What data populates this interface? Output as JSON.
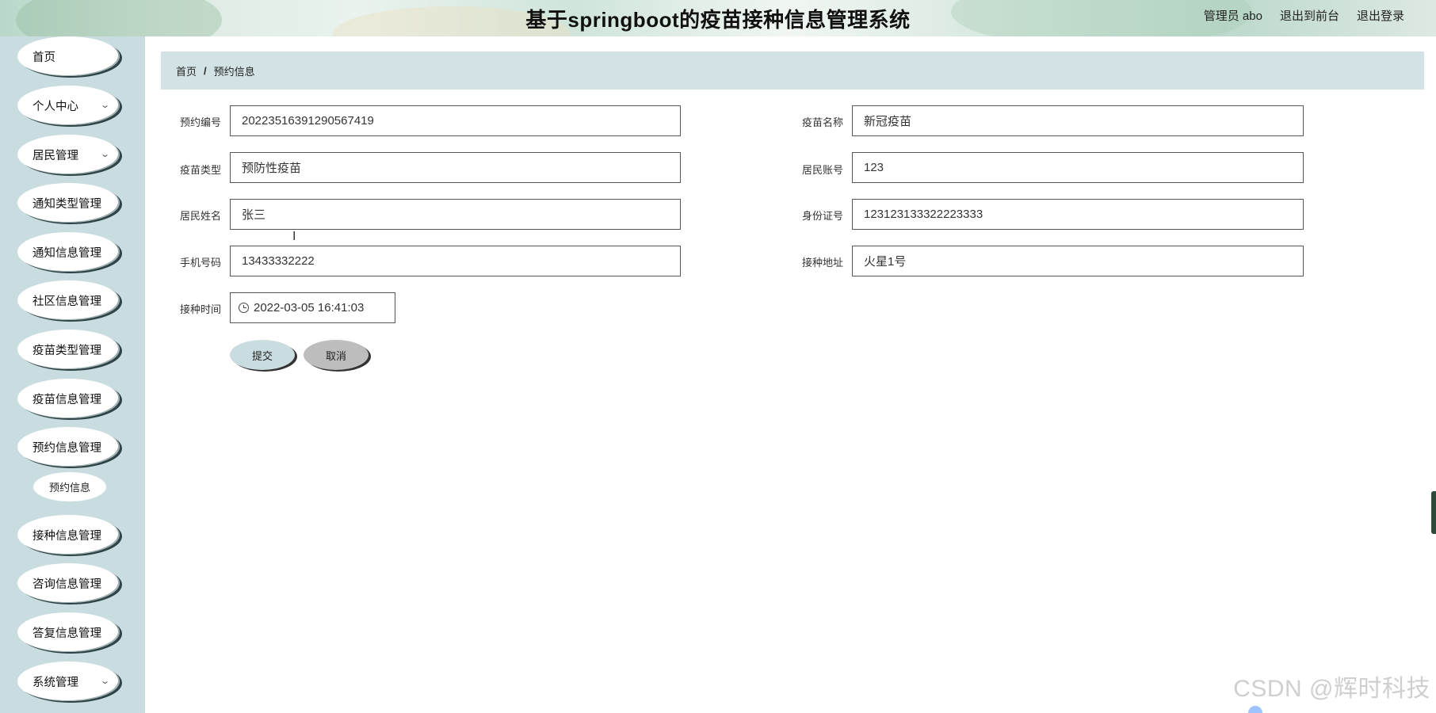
{
  "header": {
    "title": "基于springboot的疫苗接种信息管理系统",
    "user": "管理员 abo",
    "back_to_front": "退出到前台",
    "logout": "退出登录"
  },
  "sidebar": {
    "items": [
      {
        "label": "首页",
        "has_chevron": false
      },
      {
        "label": "个人中心",
        "has_chevron": true
      },
      {
        "label": "居民管理",
        "has_chevron": true
      },
      {
        "label": "通知类型管理",
        "has_chevron": false
      },
      {
        "label": "通知信息管理",
        "has_chevron": false
      },
      {
        "label": "社区信息管理",
        "has_chevron": false
      },
      {
        "label": "疫苗类型管理",
        "has_chevron": false
      },
      {
        "label": "疫苗信息管理",
        "has_chevron": false
      },
      {
        "label": "预约信息管理",
        "has_chevron": false
      },
      {
        "label": "接种信息管理",
        "has_chevron": false
      },
      {
        "label": "咨询信息管理",
        "has_chevron": false
      },
      {
        "label": "答复信息管理",
        "has_chevron": false
      },
      {
        "label": "系统管理",
        "has_chevron": true
      }
    ],
    "sub_item": "预约信息"
  },
  "breadcrumb": {
    "home": "首页",
    "separator": "/",
    "current": "预约信息"
  },
  "form": {
    "booking_no_label": "预约编号",
    "booking_no": "20223516391290567419",
    "vaccine_name_label": "疫苗名称",
    "vaccine_name": "新冠疫苗",
    "vaccine_type_label": "疫苗类型",
    "vaccine_type": "预防性疫苗",
    "resident_account_label": "居民账号",
    "resident_account": "123",
    "resident_name_label": "居民姓名",
    "resident_name": "张三",
    "id_card_label": "身份证号",
    "id_card": "123123133322223333",
    "phone_label": "手机号码",
    "phone": "13433332222",
    "address_label": "接种地址",
    "address": "火星1号",
    "time_label": "接种时间",
    "time": "2022-03-05 16:41:03",
    "submit": "提交",
    "cancel": "取消"
  },
  "watermark": "CSDN @辉时科技",
  "icons": {
    "chevron": "chevron-down-icon",
    "clock": "clock-icon",
    "text_cursor": "text-cursor-icon"
  }
}
